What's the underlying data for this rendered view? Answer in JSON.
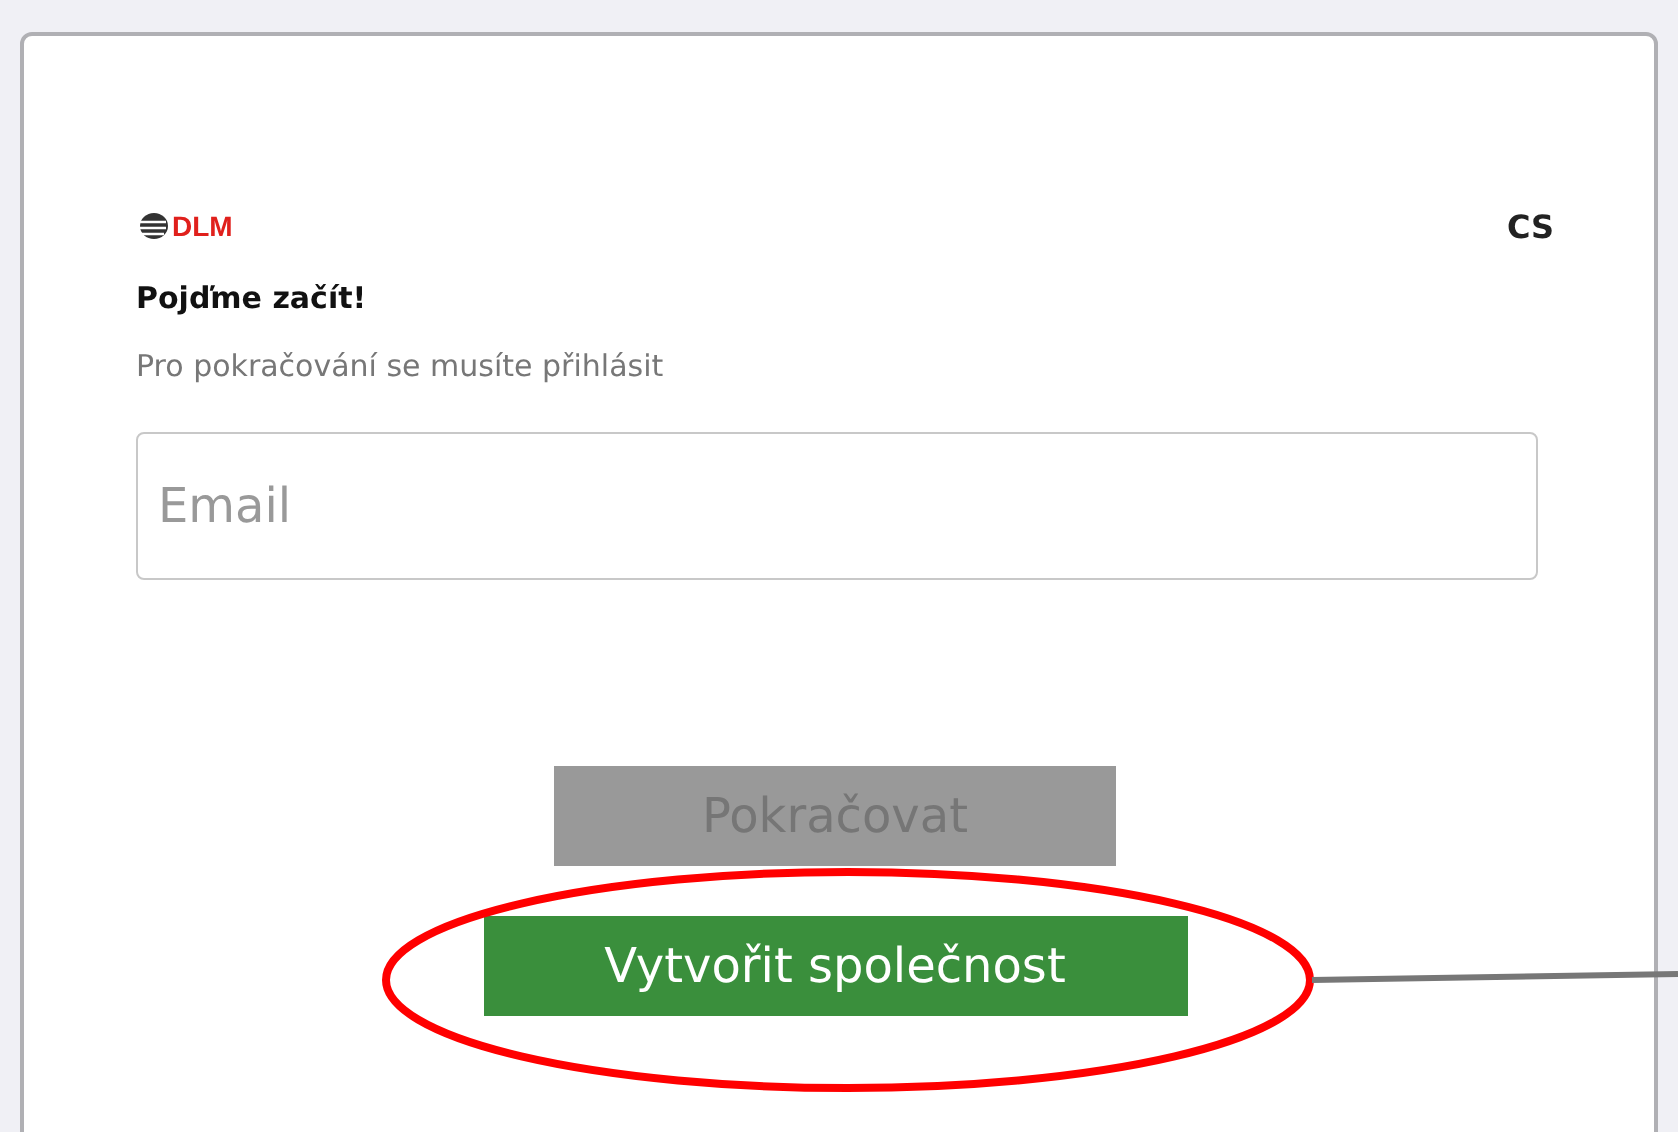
{
  "logo": {
    "text": "DLM"
  },
  "language": "CS",
  "heading": "Pojďme začít!",
  "subheading": "Pro pokračování se musíte přihlásit",
  "email_field": {
    "placeholder": "Email"
  },
  "buttons": [
    {
      "label": "Pokračovat",
      "disabled": true
    },
    {
      "label": "Vytvořit společnost",
      "disabled": false
    }
  ]
}
